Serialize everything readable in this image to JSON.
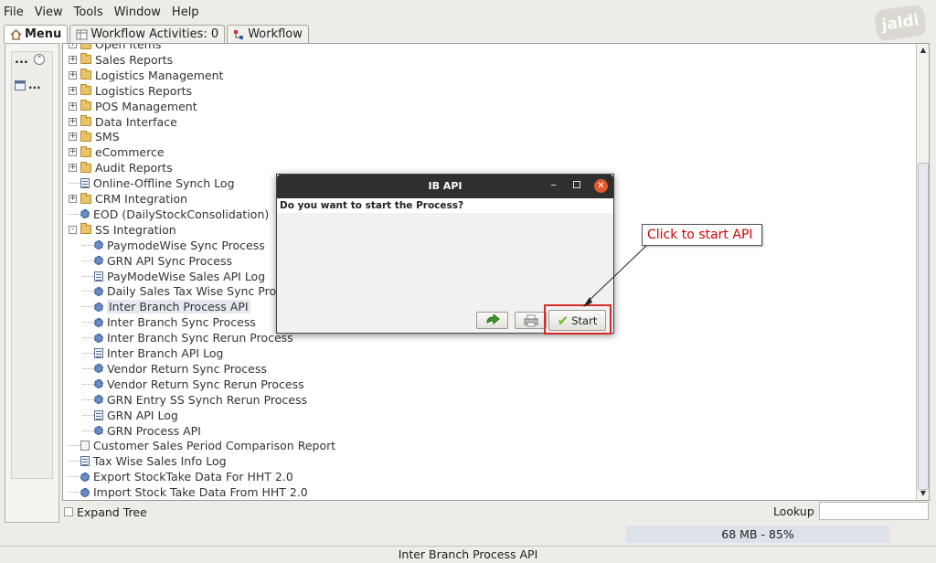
{
  "menubar": {
    "items": [
      {
        "label": "File"
      },
      {
        "label": "View"
      },
      {
        "label": "Tools"
      },
      {
        "label": "Window"
      },
      {
        "label": "Help"
      }
    ]
  },
  "logo_text": "jaldi",
  "tabs": [
    {
      "label": "Menu",
      "icon": "home-icon"
    },
    {
      "label": "Workflow Activities: 0",
      "icon": "table-icon"
    },
    {
      "label": "Workflow",
      "icon": "workflow-icon"
    }
  ],
  "left_panel": {
    "dots": "...",
    "item_label": "..."
  },
  "tree": {
    "items": [
      {
        "label": "Open Items",
        "icon": "folder",
        "level": 0,
        "expander": "+"
      },
      {
        "label": "Sales Reports",
        "icon": "folder",
        "level": 0,
        "expander": "+"
      },
      {
        "label": "Logistics Management",
        "icon": "folder",
        "level": 0,
        "expander": "+"
      },
      {
        "label": "Logistics Reports",
        "icon": "folder",
        "level": 0,
        "expander": "+"
      },
      {
        "label": "POS Management",
        "icon": "folder",
        "level": 0,
        "expander": "+"
      },
      {
        "label": "Data Interface",
        "icon": "folder",
        "level": 0,
        "expander": "+"
      },
      {
        "label": "SMS",
        "icon": "folder",
        "level": 0,
        "expander": "+"
      },
      {
        "label": "eCommerce",
        "icon": "folder",
        "level": 0,
        "expander": "+"
      },
      {
        "label": "Audit Reports",
        "icon": "folder",
        "level": 0,
        "expander": "+"
      },
      {
        "label": "Online-Offline Synch Log",
        "icon": "doc",
        "level": 0
      },
      {
        "label": "CRM Integration",
        "icon": "folder",
        "level": 0,
        "expander": "+"
      },
      {
        "label": "EOD (DailyStockConsolidation)",
        "icon": "gear",
        "level": 0
      },
      {
        "label": "SS Integration",
        "icon": "folder-open",
        "level": 0,
        "expander": "-"
      },
      {
        "label": "PaymodeWise Sync Process",
        "icon": "gear",
        "level": 1
      },
      {
        "label": "GRN API Sync Process",
        "icon": "gear",
        "level": 1
      },
      {
        "label": "PayModeWise Sales API Log",
        "icon": "doc",
        "level": 1
      },
      {
        "label": "Daily Sales Tax Wise Sync Process",
        "icon": "gear",
        "level": 1
      },
      {
        "label": "Inter Branch Process API",
        "icon": "gear",
        "level": 1,
        "selected": true
      },
      {
        "label": "Inter Branch Sync Process",
        "icon": "gear",
        "level": 1
      },
      {
        "label": "Inter Branch Sync Rerun Process",
        "icon": "gear",
        "level": 1
      },
      {
        "label": "Inter Branch API Log",
        "icon": "doc",
        "level": 1
      },
      {
        "label": "Vendor Return Sync Process",
        "icon": "gear",
        "level": 1
      },
      {
        "label": "Vendor Return Sync Rerun Process",
        "icon": "gear",
        "level": 1
      },
      {
        "label": "GRN Entry SS Synch Rerun Process",
        "icon": "gear",
        "level": 1
      },
      {
        "label": "GRN API Log",
        "icon": "doc",
        "level": 1
      },
      {
        "label": "GRN Process API",
        "icon": "gear",
        "level": 1
      },
      {
        "label": "Customer Sales Period Comparison Report",
        "icon": "plain",
        "level": 0
      },
      {
        "label": "Tax Wise Sales Info Log",
        "icon": "doc",
        "level": 0
      },
      {
        "label": "Export StockTake Data For HHT 2.0",
        "icon": "gear",
        "level": 0
      },
      {
        "label": "Import Stock Take Data From HHT 2.0",
        "icon": "gear",
        "level": 0
      }
    ]
  },
  "bottom": {
    "expand_tree_label": "Expand Tree",
    "lookup_label": "Lookup",
    "lookup_value": "",
    "memory": "68 MB - 85%"
  },
  "status_text": "Inter Branch Process API",
  "dialog": {
    "title": "IB API",
    "message": "Do you want to start the Process?",
    "start_label": "Start"
  },
  "annotation": {
    "text": "Click to start API"
  },
  "colors": {
    "annotation_red": "#d10000",
    "highlight_border": "#d42a2a",
    "titlebar": "#2f2f2f",
    "close_btn": "#e05a2b"
  }
}
